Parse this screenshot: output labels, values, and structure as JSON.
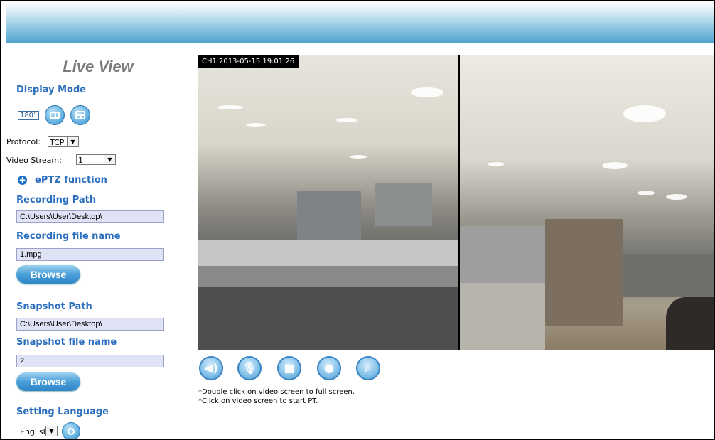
{
  "sidebar": {
    "title": "Live View",
    "display_mode": {
      "heading": "Display Mode",
      "mode_180_label": "180°"
    },
    "protocol": {
      "label": "Protocol:",
      "value": "TCP"
    },
    "video_stream": {
      "label": "Video Stream:",
      "value": "1"
    },
    "eptz": {
      "label": "ePTZ function"
    },
    "recording_path": {
      "heading": "Recording Path",
      "value": "C:\\Users\\User\\Desktop\\"
    },
    "recording_file": {
      "heading": "Recording file name",
      "value": "1.mpg",
      "browse_label": "Browse"
    },
    "snapshot_path": {
      "heading": "Snapshot Path",
      "value": "C:\\Users\\User\\Desktop\\"
    },
    "snapshot_file": {
      "heading": "Snapshot file name",
      "value": "2",
      "browse_label": "Browse"
    },
    "language": {
      "heading": "Setting Language",
      "value": "English"
    }
  },
  "video": {
    "osd_text": "CH1 2013-05-15 19:01:26"
  },
  "controls": {
    "icons": [
      "speaker-icon",
      "microphone-icon",
      "camera-icon",
      "video-camera-icon",
      "search-file-icon"
    ]
  },
  "notes": {
    "line1": "*Double click on video screen to full screen.",
    "line2": "*Click on video screen to start PT."
  },
  "colors": {
    "header_gradient_end": "#4da3d0",
    "section_heading": "#2c6fbf",
    "path_field_bg": "#dfe3f5"
  }
}
